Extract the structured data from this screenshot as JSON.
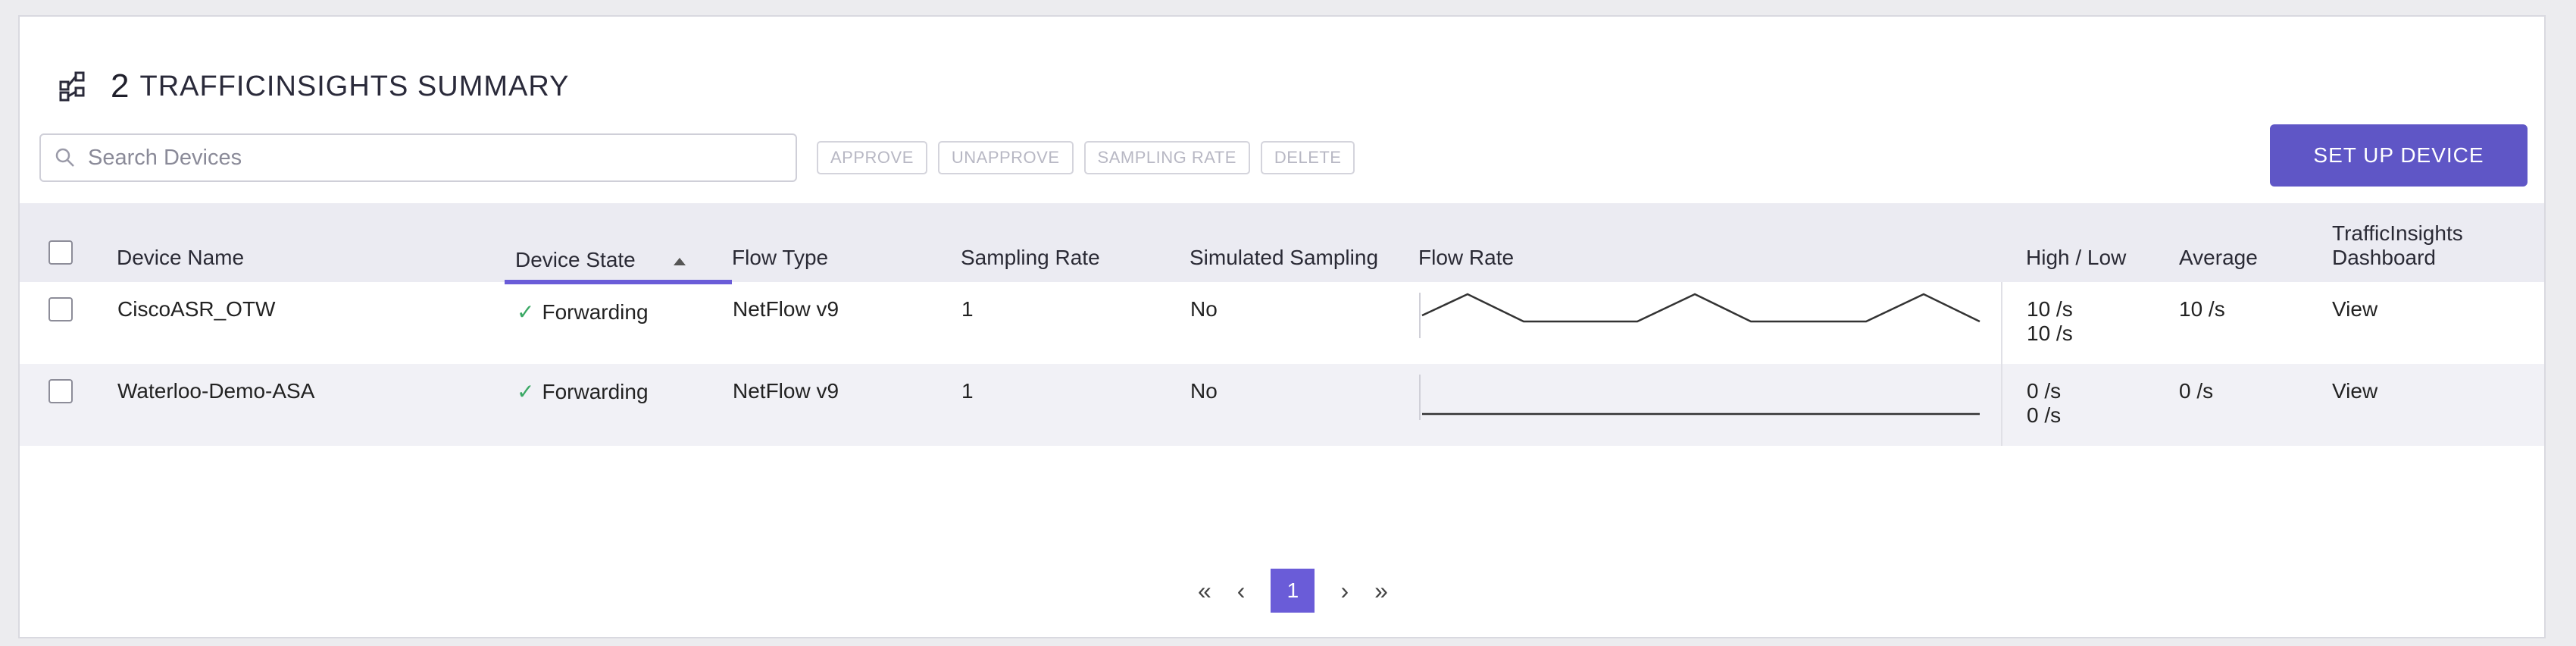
{
  "header": {
    "count": "2",
    "title": "TRAFFICINSIGHTS SUMMARY",
    "icon": "sitemap-icon"
  },
  "search": {
    "placeholder": "Search Devices",
    "value": ""
  },
  "actions": {
    "approve": "APPROVE",
    "unapprove": "UNAPPROVE",
    "sampling_rate": "SAMPLING RATE",
    "delete": "DELETE"
  },
  "setup_button": "SET UP DEVICE",
  "colors": {
    "accent": "#5f56c6",
    "check": "#3aa864"
  },
  "table": {
    "columns": {
      "device_name": "Device Name",
      "device_state": "Device State",
      "flow_type": "Flow Type",
      "sampling_rate": "Sampling Rate",
      "simulated_sampling": "Simulated Sampling",
      "flow_rate": "Flow Rate",
      "high_low": "High / Low",
      "average": "Average",
      "dashboard_line1": "TrafficInsights",
      "dashboard_line2": "Dashboard"
    },
    "rows": [
      {
        "name": "CiscoASR_OTW",
        "state": "Forwarding",
        "flow_type": "NetFlow v9",
        "sampling_rate": "1",
        "simulated": "No",
        "high": "10 /s",
        "low": "10 /s",
        "average": "10 /s",
        "dashboard": "View"
      },
      {
        "name": "Waterloo-Demo-ASA",
        "state": "Forwarding",
        "flow_type": "NetFlow v9",
        "sampling_rate": "1",
        "simulated": "No",
        "high": "0 /s",
        "low": "0 /s",
        "average": "0 /s",
        "dashboard": "View"
      }
    ]
  },
  "pagination": {
    "current": "1"
  }
}
